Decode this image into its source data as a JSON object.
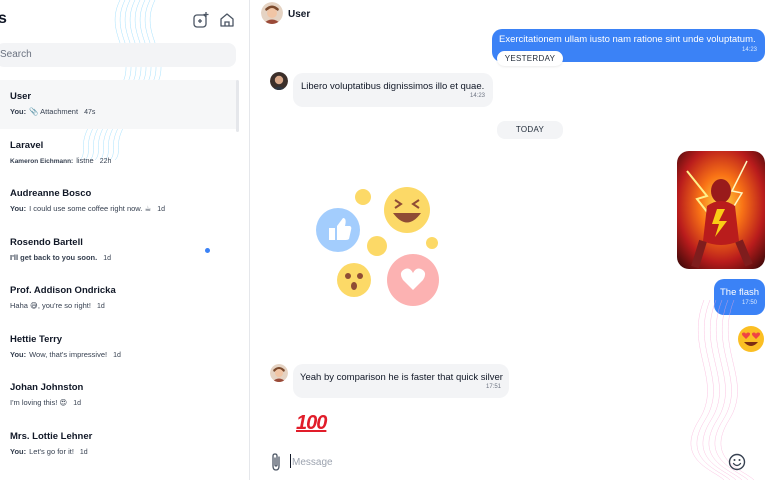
{
  "sidebar": {
    "heading": "s",
    "search": {
      "placeholder": "Search",
      "value": ""
    },
    "chats": [
      {
        "name": "User",
        "prefix": "You:",
        "message": "📎 Attachment",
        "time": "47s",
        "active": true
      },
      {
        "name": "Laravel",
        "prefix": "Kameron Eichmann:",
        "message": "listne",
        "time": "22h"
      },
      {
        "name": "Audreanne Bosco",
        "prefix": "You:",
        "message": "I could use some coffee right now. ☕",
        "time": "1d"
      },
      {
        "name": "Rosendo Bartell",
        "prefix": "",
        "message": "I'll get back to you soon.",
        "time": "1d",
        "unread": true
      },
      {
        "name": "Prof. Addison Ondricka",
        "prefix": "",
        "message": "Haha 😅, you're so right!",
        "time": "1d"
      },
      {
        "name": "Hettie Terry",
        "prefix": "You:",
        "message": "Wow, that's impressive!",
        "time": "1d"
      },
      {
        "name": "Johan Johnston",
        "prefix": "",
        "message": "I'm loving this! 😍",
        "time": "1d"
      },
      {
        "name": "Mrs. Lottie Lehner",
        "prefix": "You:",
        "message": "Let's go for it!",
        "time": "1d"
      }
    ]
  },
  "header": {
    "name": "User"
  },
  "messages": {
    "out1": {
      "text": "Exercitationem ullam iusto nam ratione sint unde voluptatum.",
      "time": "14:23"
    },
    "yesterday": "YESTERDAY",
    "in1": {
      "text": "Libero voluptatibus dignissimos illo et quae.",
      "time": "14:23"
    },
    "today": "TODAY",
    "out2": {
      "text": "The flash",
      "time": "17:50"
    },
    "in2": {
      "text": "Yeah by comparison he is faster that quick silver",
      "time": "17:51"
    },
    "emoji_100": "100"
  },
  "composer": {
    "placeholder": "Message",
    "value": ""
  },
  "colors": {
    "accent": "#3b82f6",
    "bubble_in": "#f3f4f6",
    "unread": "#3b82f6"
  },
  "icons": [
    "new-chat-icon",
    "home-icon",
    "paperclip-icon",
    "emoji-icon"
  ]
}
